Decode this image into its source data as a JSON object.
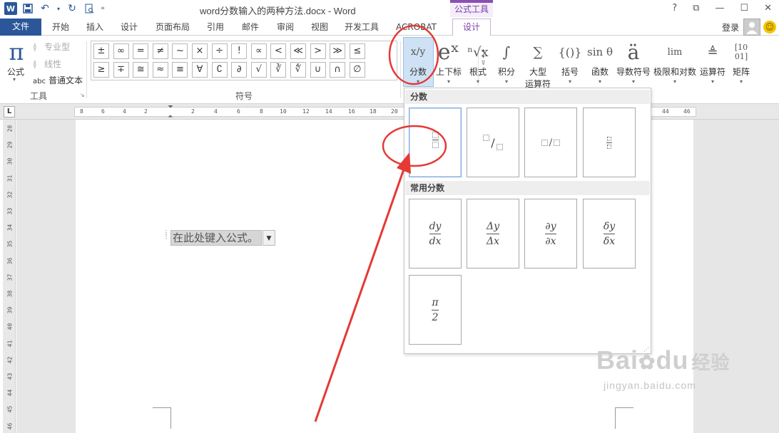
{
  "window": {
    "title": "word分数输入的两种方法.docx - Word",
    "context_tab_header": "公式工具",
    "help": "?",
    "controls": [
      "restore-ribbon",
      "minimize",
      "maximize",
      "close"
    ]
  },
  "quick_access": {
    "icons": [
      "word-logo-icon",
      "save-icon",
      "undo-icon",
      "redo-icon",
      "print-preview-icon",
      "customize-qat-icon"
    ]
  },
  "tabs": [
    {
      "label": "文件"
    },
    {
      "label": "开始"
    },
    {
      "label": "插入"
    },
    {
      "label": "设计"
    },
    {
      "label": "页面布局"
    },
    {
      "label": "引用"
    },
    {
      "label": "邮件"
    },
    {
      "label": "审阅"
    },
    {
      "label": "视图"
    },
    {
      "label": "开发工具"
    },
    {
      "label": "ACROBAT"
    },
    {
      "label": "设计"
    }
  ],
  "account": {
    "login": "登录"
  },
  "ribbon": {
    "tools_group": {
      "label": "工具",
      "equation_button": "公式",
      "equation_glyph": "π",
      "options": [
        "专业型",
        "线性",
        "普通文本"
      ],
      "plain_text_prefix": "abc"
    },
    "symbols_group": {
      "label": "符号",
      "row1": [
        "±",
        "∞",
        "=",
        "≠",
        "~",
        "×",
        "÷",
        "!",
        "∝",
        "<",
        "≪",
        ">",
        "≫",
        "≤"
      ],
      "row2": [
        "≥",
        "∓",
        "≅",
        "≈",
        "≡",
        "∀",
        "∁",
        "∂",
        "√",
        "∛",
        "∜",
        "∪",
        "∩",
        "∅"
      ]
    },
    "structures": [
      {
        "label": "分数",
        "glyph": "x/y"
      },
      {
        "label": "上下标",
        "glyph": "eˣ"
      },
      {
        "label": "根式",
        "glyph": "ⁿ√x"
      },
      {
        "label": "积分",
        "glyph": "∫"
      },
      {
        "label": "大型\n运算符",
        "label1": "大型",
        "label2": "运算符",
        "glyph": "∑"
      },
      {
        "label": "括号",
        "glyph": "{()}"
      },
      {
        "label": "函数",
        "glyph": "sin θ"
      },
      {
        "label": "导数符号",
        "glyph": "ä"
      },
      {
        "label": "极限和对数",
        "glyph": "lim"
      },
      {
        "label": "运算符",
        "glyph": "≜"
      },
      {
        "label": "矩阵",
        "glyph": "[10 01]"
      }
    ],
    "lim_sub": "n→∞"
  },
  "ruler": {
    "h_ticks": [
      "8",
      "6",
      "4",
      "2",
      "2",
      "4",
      "6",
      "8",
      "10",
      "12",
      "14",
      "16",
      "18",
      "20",
      "44",
      "46"
    ],
    "v_ticks": [
      "28",
      "29",
      "30",
      "31",
      "32",
      "33",
      "34",
      "35",
      "36",
      "37",
      "38",
      "39",
      "40",
      "41",
      "42",
      "43",
      "44",
      "45",
      "46"
    ],
    "corner": "L"
  },
  "document": {
    "equation_placeholder": "在此处键入公式。"
  },
  "gallery": {
    "section1": "分数",
    "section2": "常用分数",
    "common": [
      {
        "num": "dy",
        "den": "dx"
      },
      {
        "num": "Δy",
        "den": "Δx"
      },
      {
        "num": "∂y",
        "den": "∂x"
      },
      {
        "num": "δy",
        "den": "δx"
      },
      {
        "num": "π",
        "den": "2"
      }
    ],
    "slash": "/"
  },
  "watermark": {
    "brand": "Bai",
    "brand2": "du",
    "suffix": "经验",
    "url": "jingyan.baidu.com"
  },
  "colors": {
    "accent": "#2b579a",
    "context": "#7a3fa5",
    "annotation": "#e53935"
  }
}
